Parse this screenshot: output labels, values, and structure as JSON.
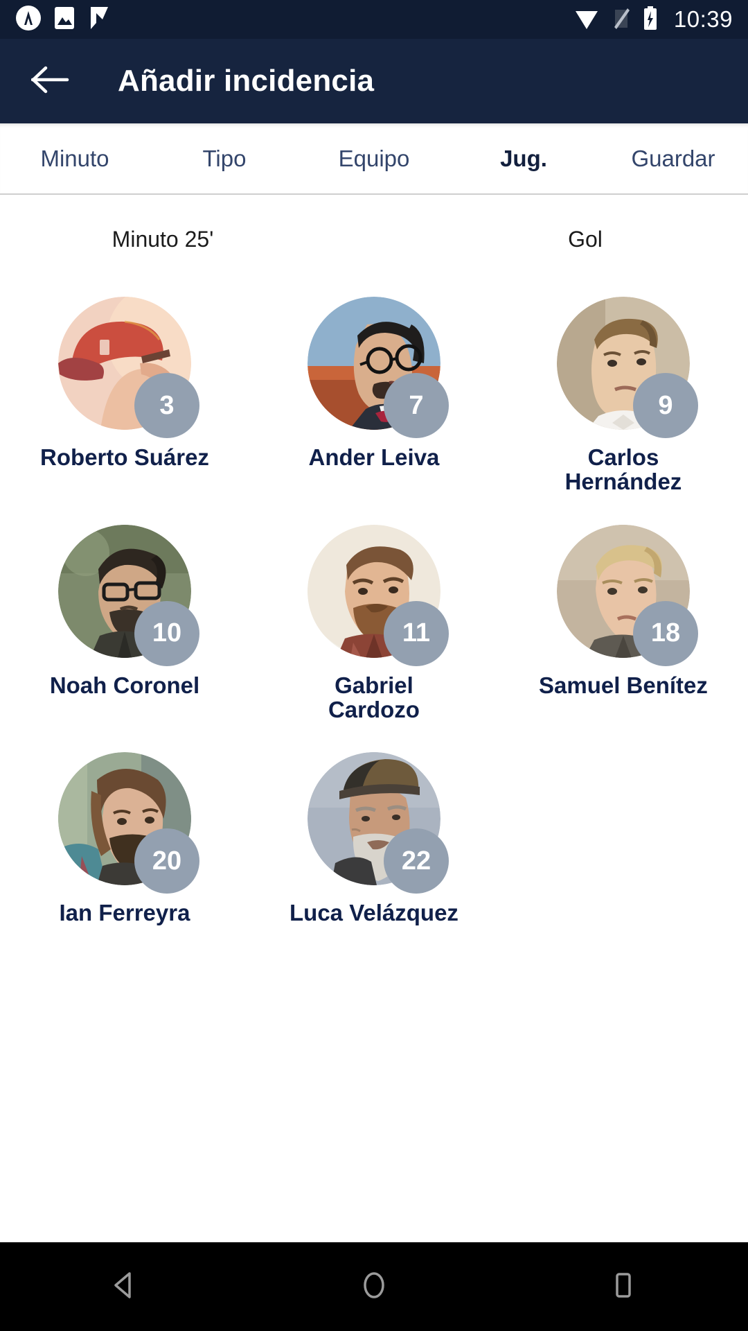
{
  "status_bar": {
    "time": "10:39",
    "left_icons": [
      "app-badge-icon",
      "image-icon",
      "checkmark-flag-icon"
    ],
    "right_icons": [
      "wifi-icon",
      "signal-off-icon",
      "battery-charging-icon"
    ],
    "background": "#101c33"
  },
  "app_bar": {
    "title": "Añadir incidencia",
    "back_icon": "arrow-left-icon",
    "background": "#16243f",
    "text_color": "#ffffff"
  },
  "tabs": {
    "active_index": 3,
    "items": [
      {
        "label": "Minuto"
      },
      {
        "label": "Tipo"
      },
      {
        "label": "Equipo"
      },
      {
        "label": "Jug."
      },
      {
        "label": "Guardar"
      }
    ],
    "active_color": "#121f3d",
    "inactive_color": "#33456b"
  },
  "summary": {
    "minute": "Minuto 25'",
    "type": "Gol"
  },
  "players": [
    {
      "name": "Roberto Suárez",
      "number": "3",
      "avatar": "player-avatar-cap",
      "bg": "#e8c9bf",
      "skin": "#e8c3a8",
      "hair": "#b8302f",
      "shirt": "#6b2440"
    },
    {
      "name": "Ander Leiva",
      "number": "7",
      "avatar": "player-avatar-glasses",
      "bg": "#8fa6b8",
      "skin": "#d9ae8c",
      "hair": "#22201f",
      "shirt": "#2a2f3a"
    },
    {
      "name": "Carlos Hernández",
      "number": "9",
      "avatar": "player-avatar-blond",
      "bg": "#cbb49c",
      "skin": "#e3bb99",
      "hair": "#8a6b43",
      "shirt": "#f2f1ef"
    },
    {
      "name": "Noah Coronel",
      "number": "10",
      "avatar": "player-avatar-beard",
      "bg": "#7d8a6c",
      "skin": "#cfa786",
      "hair": "#2e2720",
      "shirt": "#3a3a33"
    },
    {
      "name": "Gabriel Cardozo",
      "number": "11",
      "avatar": "player-avatar-redbeard",
      "bg": "#f0ece3",
      "skin": "#e2b693",
      "hair": "#7a5437",
      "shirt": "#8c4436"
    },
    {
      "name": "Samuel Benítez",
      "number": "18",
      "avatar": "player-avatar-young",
      "bg": "#bcae9c",
      "skin": "#e8c4a6",
      "hair": "#d8c18b",
      "shirt": "#5e5a52"
    },
    {
      "name": "Ian Ferreyra",
      "number": "20",
      "avatar": "player-avatar-longhair",
      "bg": "#9aaa94",
      "skin": "#dbb295",
      "hair": "#6a4a32",
      "shirt": "#4e8a94"
    },
    {
      "name": "Luca Velázquez",
      "number": "22",
      "avatar": "player-avatar-oldman",
      "bg": "#aab3c0",
      "skin": "#c79a7b",
      "hair": "#d8d4cc",
      "shirt": "#3b3b3c"
    }
  ],
  "badge": {
    "background": "#93a0b0",
    "text_color": "#ffffff"
  },
  "nav_bar": {
    "buttons": [
      "nav-back-icon",
      "nav-home-icon",
      "nav-recents-icon"
    ],
    "background": "#000000"
  }
}
